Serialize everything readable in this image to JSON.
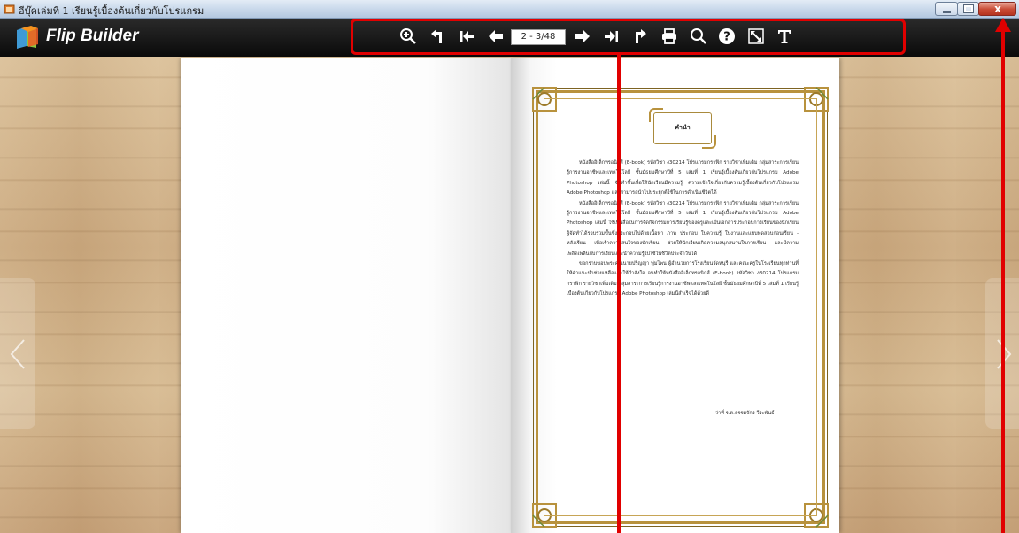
{
  "window": {
    "title": "อีบุ๊คเล่มที่ 1 เรียนรู้เบื้องต้นเกี่ยวกับโปรแกรม",
    "close_label": "x"
  },
  "toolbar": {
    "logo_text": "Flip Builder",
    "page_indicator": "2 - 3/48",
    "buttons": [
      {
        "name": "zoom-in",
        "icon": "zoom-in-icon"
      },
      {
        "name": "back",
        "icon": "undo-arrow-icon"
      },
      {
        "name": "first-page",
        "icon": "first-page-icon"
      },
      {
        "name": "previous-page",
        "icon": "arrow-left-icon"
      },
      {
        "name": "next-page",
        "icon": "arrow-right-icon"
      },
      {
        "name": "last-page",
        "icon": "last-page-icon"
      },
      {
        "name": "share",
        "icon": "share-arrow-icon"
      },
      {
        "name": "print",
        "icon": "print-icon"
      },
      {
        "name": "search",
        "icon": "search-icon"
      },
      {
        "name": "help",
        "icon": "help-icon"
      },
      {
        "name": "fullscreen",
        "icon": "fullscreen-icon"
      },
      {
        "name": "text",
        "icon": "text-icon"
      }
    ],
    "icon_color": "#ffffff"
  },
  "page": {
    "heading": "คำนำ",
    "paragraphs": [
      "หนังสืออิเล็กทรอนิกส์ (E-book) รหัสวิชา ง30214 โปรแกรมกราฟิก รายวิชาเพิ่มเติม กลุ่มสาระการเรียนรู้การงานอาชีพและเทคโนโลยี ชั้นมัธยมศึกษาปีที่ 5 เล่มที่ 1 เรียนรู้เบื้องต้นเกี่ยวกับโปรแกรม Adobe Photoshop เล่มนี้ จัดทำขึ้นเพื่อให้นักเรียนมีความรู้ ความเข้าใจเกี่ยวกับความรู้เบื้องต้นเกี่ยวกับโปรแกรม Adobe Photoshop และสามารถนำไปประยุกต์ใช้ในการดำเนินชีวิตได้",
      "หนังสืออิเล็กทรอนิกส์ (E-book) รหัสวิชา ง30214 โปรแกรมกราฟิก รายวิชาเพิ่มเติม กลุ่มสาระการเรียนรู้การงานอาชีพและเทคโนโลยี ชั้นมัธยมศึกษาปีที่ 5 เล่มที่ 1 เรียนรู้เบื้องต้นเกี่ยวกับโปรแกรม Adobe Photoshop เล่มนี้ ใช้เป็นสื่อในการจัดกิจกรรมการเรียนรู้ของครูและเป็นเอกสารประกอบการเรียนของนักเรียน ผู้จัดทำได้รวบรวมขึ้นซึ่งประกอบไปด้วยเนื้อหา ภาพ ประกอบ ใบความรู้ ใบงานและแบบทดสอบก่อนเรียน - หลังเรียน เพื่อเร้าความสนใจของนักเรียน ช่วยให้นักเรียนเกิดความสนุกสนานในการเรียน และมีความเพลิดเพลินกับการเรียนและนำความรู้ไปใช้ในชีวิตประจำวันได้",
      "ขอกราบขอบพระคุณนายปริญญา พุ่มไพน ผู้อำนวยการโรงเรียนวัดหนุรี และคณะครูในโรงเรียนทุกท่านที่ให้คำแนะนำช่วยเหลือและให้กำลังใจ จนทำให้หนังสืออิเล็กทรอนิกส์ (E-book) รหัสวิชา ง30214 โปรแกรมกราฟิก รายวิชาเพิ่มเติม กลุ่มสาระการเรียนรู้การงานอาชีพและเทคโนโลยี ชั้นมัธยมศึกษาปีที่ 5 เล่มที่ 1 เรียนรู้เบื้องต้นเกี่ยวกับโปรแกรม Adobe Photoshop เล่มนี้สำเร็จได้ด้วยดี"
    ],
    "signature": "ว่าที่ ร.ต.ธรรมจักร วีระพันธ์"
  },
  "colors": {
    "annotation": "#e10000",
    "frame_gold": "#b8923d"
  }
}
